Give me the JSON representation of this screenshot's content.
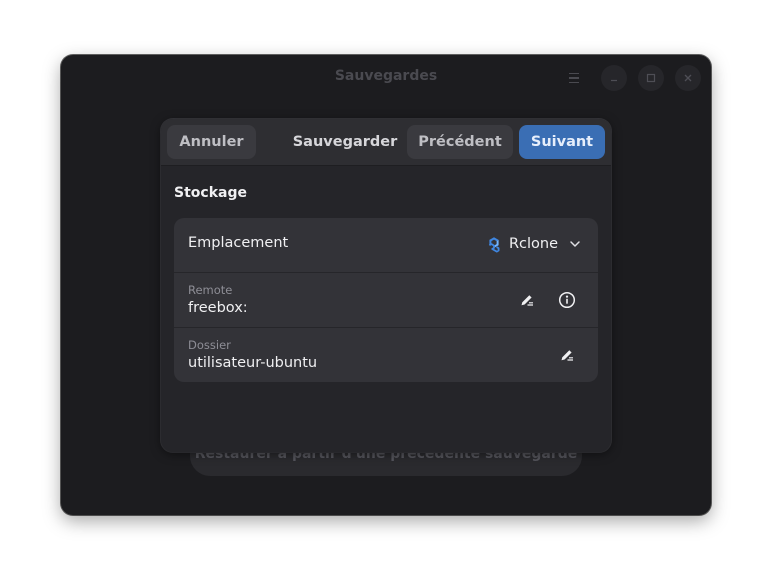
{
  "window": {
    "title": "Sauvegardes"
  },
  "background": {
    "restore_label": "Restaurer à partir d'une précédente sauvegarde"
  },
  "dialog": {
    "title": "Sauvegarder",
    "cancel_label": "Annuler",
    "previous_label": "Précédent",
    "next_label": "Suivant"
  },
  "storage": {
    "section_title": "Stockage",
    "location": {
      "label": "Emplacement",
      "value": "Rclone",
      "icon": "rclone-icon"
    },
    "remote": {
      "label": "Remote",
      "value": "freebox:"
    },
    "folder": {
      "label": "Dossier",
      "value": "utilisateur-ubuntu"
    }
  },
  "colors": {
    "accent": "#3a6eb4",
    "window_bg": "#1c1c1f",
    "dialog_bg": "#252529",
    "list_bg": "#333338"
  }
}
